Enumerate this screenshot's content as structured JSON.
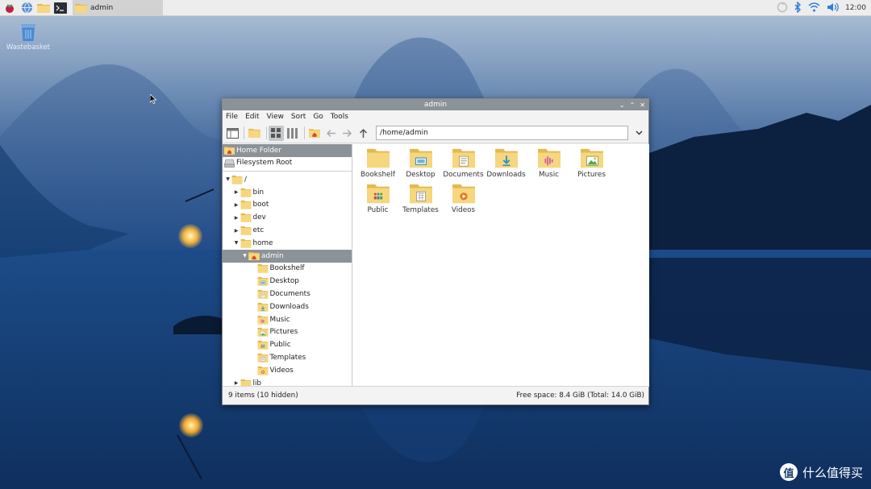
{
  "taskbar": {
    "task_label": "admin",
    "clock": "12:00"
  },
  "desktop": {
    "wastebasket_label": "Wastebasket",
    "watermark": "什么值得买",
    "watermark_badge": "值"
  },
  "window": {
    "title": "admin",
    "menu": [
      "File",
      "Edit",
      "View",
      "Sort",
      "Go",
      "Tools"
    ],
    "path": "/home/admin",
    "places": [
      {
        "label": "Home Folder",
        "icon": "home-icon"
      },
      {
        "label": "Filesystem Root",
        "icon": "drive-icon"
      }
    ],
    "tree": [
      {
        "label": "/",
        "arrow": "▼",
        "depth": 0
      },
      {
        "label": "bin",
        "arrow": "▶",
        "depth": 1
      },
      {
        "label": "boot",
        "arrow": "▶",
        "depth": 1
      },
      {
        "label": "dev",
        "arrow": "▶",
        "depth": 1
      },
      {
        "label": "etc",
        "arrow": "▶",
        "depth": 1
      },
      {
        "label": "home",
        "arrow": "▼",
        "depth": 1
      },
      {
        "label": "admin",
        "arrow": "▼",
        "depth": 2
      },
      {
        "label": "Bookshelf",
        "arrow": "",
        "depth": 3
      },
      {
        "label": "Desktop",
        "arrow": "",
        "depth": 3
      },
      {
        "label": "Documents",
        "arrow": "",
        "depth": 3
      },
      {
        "label": "Downloads",
        "arrow": "",
        "depth": 3
      },
      {
        "label": "Music",
        "arrow": "",
        "depth": 3
      },
      {
        "label": "Pictures",
        "arrow": "",
        "depth": 3
      },
      {
        "label": "Public",
        "arrow": "",
        "depth": 3
      },
      {
        "label": "Templates",
        "arrow": "",
        "depth": 3
      },
      {
        "label": "Videos",
        "arrow": "",
        "depth": 3
      },
      {
        "label": "lib",
        "arrow": "▶",
        "depth": 1
      }
    ],
    "items": [
      {
        "label": "Bookshelf",
        "icon": "folder-icon"
      },
      {
        "label": "Desktop",
        "icon": "desktop-folder-icon"
      },
      {
        "label": "Documents",
        "icon": "documents-folder-icon"
      },
      {
        "label": "Downloads",
        "icon": "downloads-folder-icon"
      },
      {
        "label": "Music",
        "icon": "music-folder-icon"
      },
      {
        "label": "Pictures",
        "icon": "pictures-folder-icon"
      },
      {
        "label": "Public",
        "icon": "public-folder-icon"
      },
      {
        "label": "Templates",
        "icon": "templates-folder-icon"
      },
      {
        "label": "Videos",
        "icon": "videos-folder-icon"
      }
    ],
    "status_left": "9 items (10 hidden)",
    "status_right": "Free space: 8.4 GiB (Total: 14.0 GiB)"
  },
  "colors": {
    "selection": "#8b9298",
    "folder": "#f6d77f",
    "folder_dark": "#e4b94c"
  }
}
